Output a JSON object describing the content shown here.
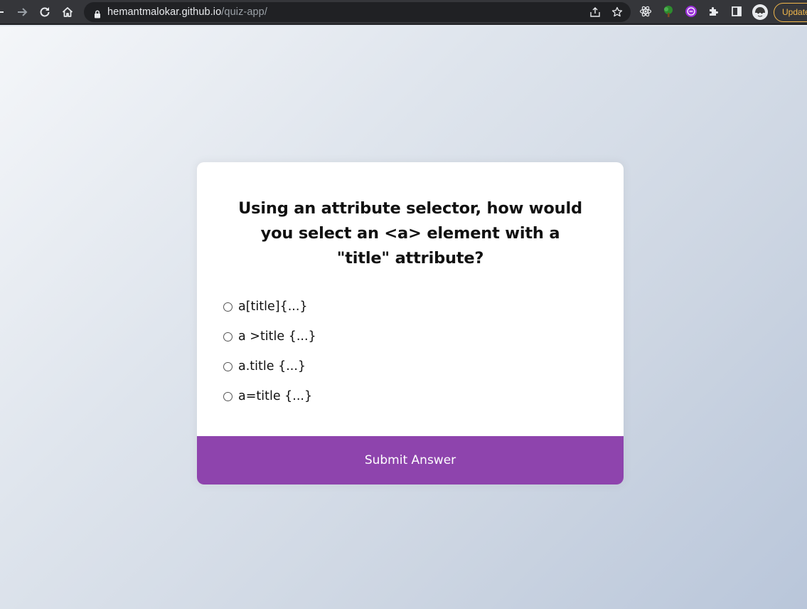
{
  "browser": {
    "url_domain": "hemantmalokar.github.io",
    "url_path": "/quiz-app/",
    "update_label": "Update",
    "colors": {
      "toolbar": "#35363a",
      "omnibox": "#202124",
      "update_accent": "#f2b84b"
    },
    "icons": [
      "back-icon",
      "forward-icon",
      "reload-icon",
      "home-icon",
      "lock-icon",
      "share-icon",
      "bookmark-star-icon",
      "react-devtools-icon",
      "tree-extension-icon",
      "purple-extension-icon",
      "extensions-puzzle-icon",
      "side-panel-icon",
      "profile-avatar"
    ]
  },
  "quiz": {
    "question": "Using an attribute selector, how would you select an <a> element with a \"title\" attribute?",
    "answers": [
      {
        "label": "a[title]{...}"
      },
      {
        "label": "a >title {...}"
      },
      {
        "label": "a.title {...}"
      },
      {
        "label": "a=title {...}"
      }
    ],
    "submit_label": "Submit Answer",
    "colors": {
      "accent": "#8e44ad",
      "card": "#ffffff"
    }
  }
}
